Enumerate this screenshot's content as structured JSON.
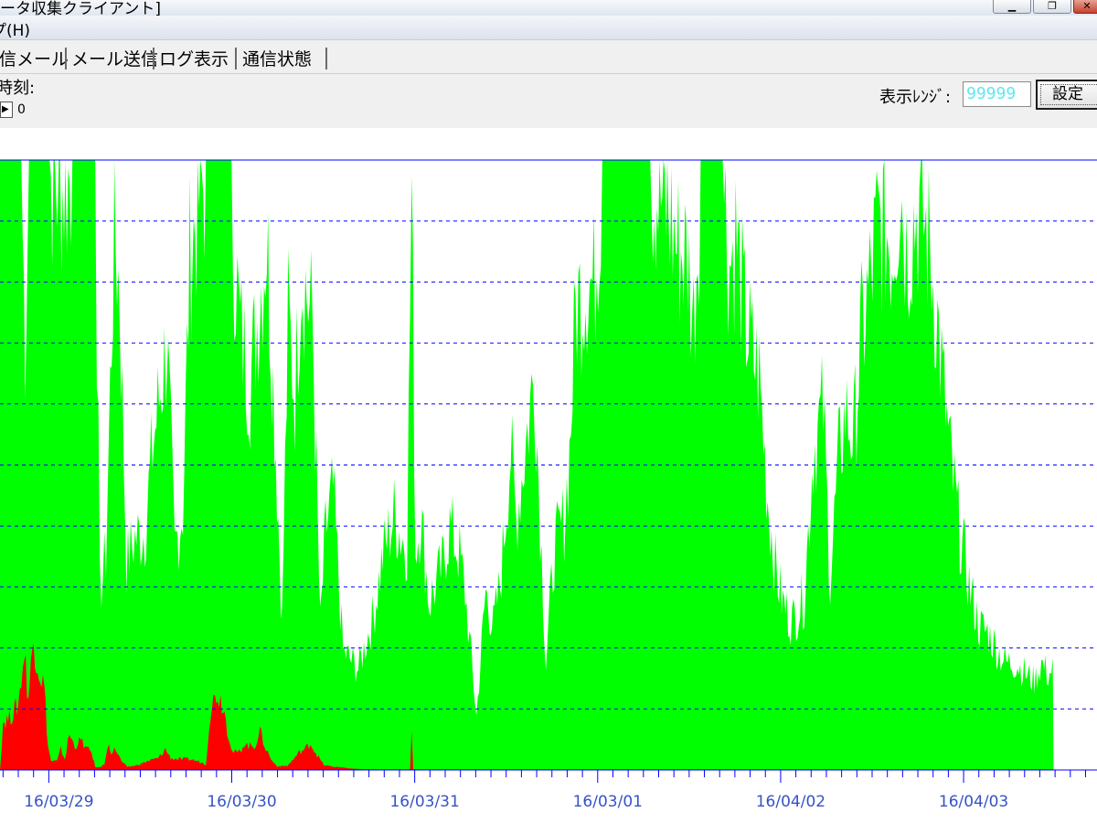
{
  "window": {
    "title": "ータ収集クライアント]",
    "buttons": [
      "minimize-button",
      "maximize-button",
      "close-button"
    ]
  },
  "menu": {
    "items": [
      {
        "label": "プ(H)"
      }
    ]
  },
  "tabs": [
    {
      "label": "受信メール"
    },
    {
      "label": "メール送信"
    },
    {
      "label": "ログ表示"
    },
    {
      "label": "通信状態"
    }
  ],
  "controls": {
    "time_label": "時刻:",
    "spin_value": "0",
    "range_label": "表示ﾚﾝｼﾞ:",
    "range_value": "99999",
    "set_button_label": "設定"
  },
  "colors": {
    "green_series": "#00ff00",
    "red_series": "#ff0000",
    "grid": "#0000ff",
    "axis_labels": "#3553c8",
    "range_text": "#5fe8f0"
  },
  "chart_data": {
    "type": "area",
    "x_unit": "hours since 16/03/29 00:00",
    "y_max": 99999,
    "xlim": [
      -6.4,
      137.5
    ],
    "grid": "horizontal dashed",
    "x_tick_labels": [
      {
        "label": "16/03/29",
        "x": 0
      },
      {
        "label": "16/03/30",
        "x": 24
      },
      {
        "label": "16/03/31",
        "x": 48
      },
      {
        "label": "16/03/01",
        "x": 72
      },
      {
        "label": "16/04/02",
        "x": 96
      },
      {
        "label": "16/04/03",
        "x": 120
      }
    ],
    "series": [
      {
        "color": "#00ff00",
        "points": [
          [
            -6.4,
            100000
          ],
          [
            -3.6,
            100000
          ],
          [
            -3.1,
            72000
          ],
          [
            -2.6,
            100000
          ],
          [
            -0.6,
            100000
          ],
          [
            0.1,
            100000
          ],
          [
            2.0,
            98000
          ],
          [
            3.1,
            100000
          ],
          [
            3.9,
            100000
          ],
          [
            5.5,
            100000
          ],
          [
            6.1,
            100000
          ],
          [
            6.7,
            30000
          ],
          [
            7.5,
            36000
          ],
          [
            8.6,
            92000
          ],
          [
            9.3,
            80000
          ],
          [
            10.2,
            35000
          ],
          [
            11.3,
            39000
          ],
          [
            12.6,
            40000
          ],
          [
            13.6,
            54000
          ],
          [
            15.5,
            72000
          ],
          [
            16.5,
            37000
          ],
          [
            17.6,
            44000
          ],
          [
            18.5,
            86000
          ],
          [
            19.7,
            96000
          ],
          [
            20.6,
            100000
          ],
          [
            23.6,
            100000
          ],
          [
            25.1,
            74000
          ],
          [
            26.4,
            65000
          ],
          [
            28.6,
            90000
          ],
          [
            29.6,
            60000
          ],
          [
            30.6,
            25000
          ],
          [
            31.4,
            76000
          ],
          [
            32.3,
            63000
          ],
          [
            33.1,
            85000
          ],
          [
            34.6,
            75000
          ],
          [
            35.6,
            24000
          ],
          [
            36.3,
            40000
          ],
          [
            37.3,
            47000
          ],
          [
            38.6,
            20000
          ],
          [
            40.6,
            17000
          ],
          [
            42.6,
            26000
          ],
          [
            43.8,
            36000
          ],
          [
            45.3,
            43000
          ],
          [
            46.3,
            39000
          ],
          [
            47.0,
            38000
          ],
          [
            47.6,
            98000
          ],
          [
            48.1,
            37000
          ],
          [
            48.8,
            43000
          ],
          [
            49.9,
            28000
          ],
          [
            51.6,
            34000
          ],
          [
            52.6,
            41000
          ],
          [
            53.9,
            36000
          ],
          [
            54.6,
            30000
          ],
          [
            55.4,
            19000
          ],
          [
            56.1,
            9000
          ],
          [
            57.3,
            30000
          ],
          [
            58.3,
            24000
          ],
          [
            59.2,
            31000
          ],
          [
            60.6,
            54000
          ],
          [
            61.3,
            42000
          ],
          [
            62.2,
            51000
          ],
          [
            63.7,
            67000
          ],
          [
            65.2,
            18000
          ],
          [
            66.3,
            37000
          ],
          [
            67.6,
            42000
          ],
          [
            68.3,
            53000
          ],
          [
            69.1,
            77000
          ],
          [
            70.6,
            83000
          ],
          [
            71.5,
            81000
          ],
          [
            72.6,
            100000
          ],
          [
            75.4,
            100000
          ],
          [
            76.9,
            100000
          ],
          [
            78.9,
            100000
          ],
          [
            80.3,
            96000
          ],
          [
            81.3,
            94000
          ],
          [
            82.4,
            88000
          ],
          [
            83.8,
            86000
          ],
          [
            84.6,
            76000
          ],
          [
            85.5,
            100000
          ],
          [
            88.4,
            100000
          ],
          [
            89.3,
            85000
          ],
          [
            90.1,
            90000
          ],
          [
            91.3,
            76000
          ],
          [
            92.3,
            70000
          ],
          [
            93.2,
            66000
          ],
          [
            94.3,
            46000
          ],
          [
            95.3,
            34000
          ],
          [
            96.3,
            28000
          ],
          [
            97.5,
            25000
          ],
          [
            99.1,
            29000
          ],
          [
            100.3,
            54000
          ],
          [
            101.6,
            61000
          ],
          [
            102.5,
            32000
          ],
          [
            103.6,
            52000
          ],
          [
            104.5,
            60000
          ],
          [
            105.6,
            56000
          ],
          [
            106.6,
            73000
          ],
          [
            107.5,
            80000
          ],
          [
            108.6,
            90000
          ],
          [
            109.6,
            92000
          ],
          [
            110.6,
            88000
          ],
          [
            111.7,
            99000
          ],
          [
            112.5,
            88000
          ],
          [
            113.6,
            93000
          ],
          [
            114.4,
            95000
          ],
          [
            115.6,
            87000
          ],
          [
            116.4,
            78000
          ],
          [
            117.3,
            65000
          ],
          [
            118.3,
            52000
          ],
          [
            119.5,
            40000
          ],
          [
            120.9,
            30000
          ],
          [
            122.1,
            24000
          ],
          [
            123.3,
            23000
          ],
          [
            124.5,
            20000
          ],
          [
            125.6,
            18000
          ],
          [
            126.9,
            18000
          ],
          [
            128.3,
            16000
          ],
          [
            129.3,
            15000
          ],
          [
            130.2,
            18000
          ],
          [
            131.1,
            16000
          ],
          [
            131.7,
            17000
          ],
          [
            131.8,
            0
          ]
        ]
      },
      {
        "color": "#ff0000",
        "points": [
          [
            -6.4,
            0
          ],
          [
            -6.0,
            8000
          ],
          [
            -5.0,
            9000
          ],
          [
            -4.0,
            11000
          ],
          [
            -3.2,
            20000
          ],
          [
            -2.7,
            12000
          ],
          [
            -2.0,
            22000
          ],
          [
            -1.3,
            17000
          ],
          [
            -0.6,
            14000
          ],
          [
            -0.1,
            4000
          ],
          [
            0.3,
            1500
          ],
          [
            1.1,
            1500
          ],
          [
            1.6,
            3500
          ],
          [
            2.1,
            1800
          ],
          [
            2.7,
            6000
          ],
          [
            3.4,
            4000
          ],
          [
            4.2,
            5000
          ],
          [
            5.0,
            3500
          ],
          [
            5.6,
            3000
          ],
          [
            6.1,
            500
          ],
          [
            6.3,
            400
          ],
          [
            6.8,
            500
          ],
          [
            7.3,
            1000
          ],
          [
            7.9,
            4500
          ],
          [
            8.2,
            3000
          ],
          [
            8.8,
            3500
          ],
          [
            9.5,
            1500
          ],
          [
            10.3,
            500
          ],
          [
            11.6,
            800
          ],
          [
            13.0,
            1500
          ],
          [
            14.4,
            2000
          ],
          [
            15.3,
            3500
          ],
          [
            16.0,
            2000
          ],
          [
            16.9,
            1800
          ],
          [
            18.6,
            1800
          ],
          [
            20.0,
            1300
          ],
          [
            20.6,
            900
          ],
          [
            21.2,
            10000
          ],
          [
            22.0,
            13000
          ],
          [
            22.9,
            11000
          ],
          [
            23.4,
            7000
          ],
          [
            24.1,
            3000
          ],
          [
            25.1,
            3000
          ],
          [
            25.6,
            4500
          ],
          [
            26.2,
            4000
          ],
          [
            27.0,
            4000
          ],
          [
            27.7,
            6500
          ],
          [
            28.5,
            3500
          ],
          [
            29.3,
            1500
          ],
          [
            30.0,
            600
          ],
          [
            31.3,
            700
          ],
          [
            32.1,
            1800
          ],
          [
            32.9,
            3000
          ],
          [
            33.6,
            3500
          ],
          [
            34.3,
            4500
          ],
          [
            35.2,
            2500
          ],
          [
            36.1,
            800
          ],
          [
            37.0,
            600
          ],
          [
            38.7,
            400
          ],
          [
            39.4,
            250
          ],
          [
            41.0,
            150
          ],
          [
            46.0,
            100
          ],
          [
            47.4,
            100
          ],
          [
            47.6,
            7000
          ],
          [
            47.8,
            100
          ],
          [
            54.0,
            100
          ],
          [
            59.0,
            100
          ],
          [
            70.0,
            100
          ],
          [
            100.0,
            100
          ],
          [
            131.7,
            100
          ],
          [
            131.8,
            0
          ]
        ]
      }
    ]
  }
}
